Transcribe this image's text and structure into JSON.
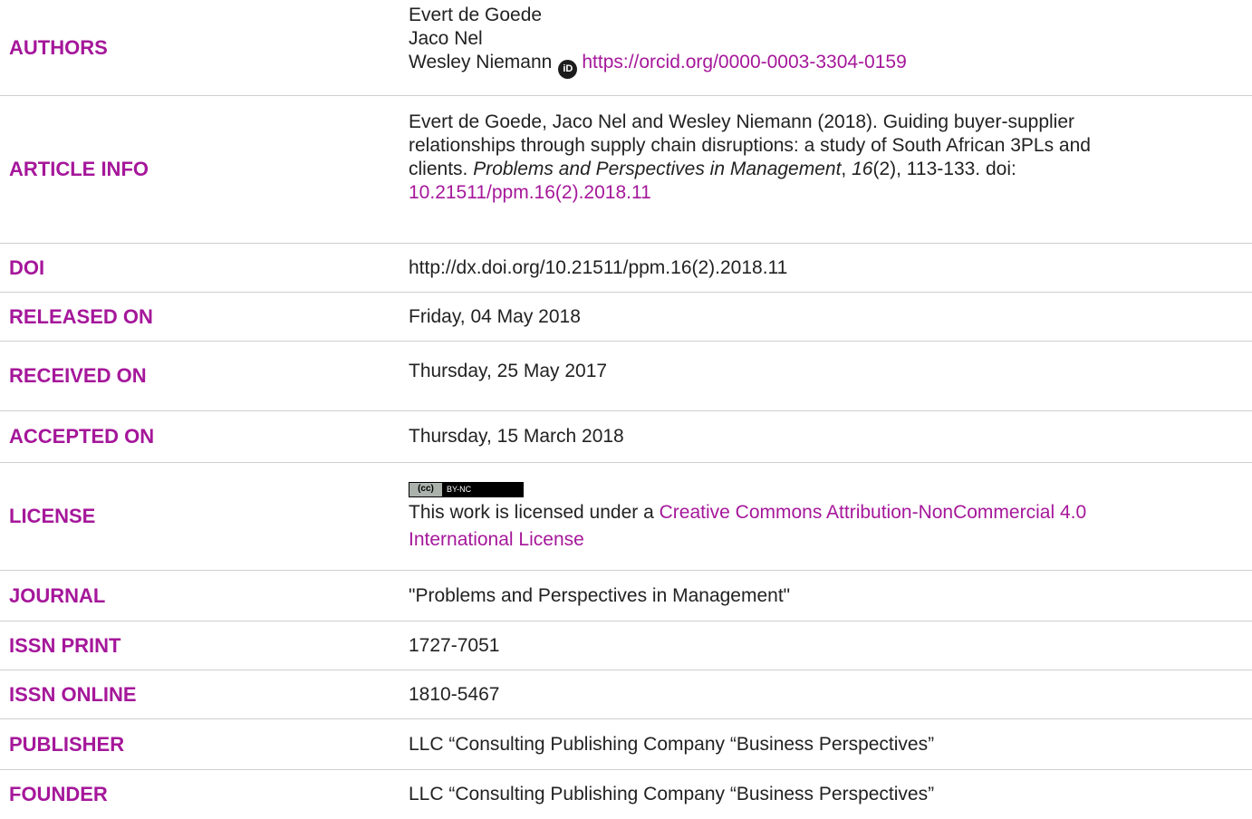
{
  "authors": {
    "label": "AUTHORS",
    "names": [
      "Evert de Goede",
      "Jaco Nel",
      "Wesley Niemann"
    ],
    "orcid_url": "https://orcid.org/0000-0003-3304-0159",
    "orcid_icon": "orcid-icon"
  },
  "article_info": {
    "label": "ARTICLE INFO",
    "line1": "Evert de Goede, Jaco Nel and Wesley Niemann (2018). Guiding buyer-supplier",
    "line2": "relationships through supply chain disruptions: a study of South African 3PLs and",
    "line3_pre": "clients. ",
    "journal_italic": "Problems and Perspectives in Management",
    "comma": ", ",
    "volume_italic": "16",
    "line3_post": "(2), 113-133. doi:",
    "doi_link": "10.21511/ppm.16(2).2018.11"
  },
  "doi": {
    "label": "DOI",
    "value": "http://dx.doi.org/10.21511/ppm.16(2).2018.11"
  },
  "released": {
    "label": "RELEASED ON",
    "value": "Friday, 04 May 2018"
  },
  "received": {
    "label": "RECEIVED ON",
    "value": "Thursday, 25 May 2017"
  },
  "accepted": {
    "label": "ACCEPTED ON",
    "value": "Thursday, 15 March 2018"
  },
  "license": {
    "label": "LICENSE",
    "badge_left": "(cc)",
    "badge_right": "BY-NC",
    "text_pre": "This work is licensed under a ",
    "link_line1": "Creative Commons Attribution-NonCommercial 4.0",
    "link_line2": "International License"
  },
  "journal": {
    "label": "JOURNAL",
    "value": "\"Problems and Perspectives in Management\""
  },
  "issn_print": {
    "label": "ISSN PRINT",
    "value": "1727-7051"
  },
  "issn_online": {
    "label": "ISSN ONLINE",
    "value": "1810-5467"
  },
  "publisher": {
    "label": "PUBLISHER",
    "value": "LLC “Consulting Publishing Company “Business Perspectives”"
  },
  "founder": {
    "label": "FOUNDER",
    "value": "LLC “Consulting Publishing Company “Business Perspectives”"
  },
  "colors": {
    "label_color": "#a5179a",
    "text_color": "#222222",
    "divider": "#cfcfcf"
  }
}
